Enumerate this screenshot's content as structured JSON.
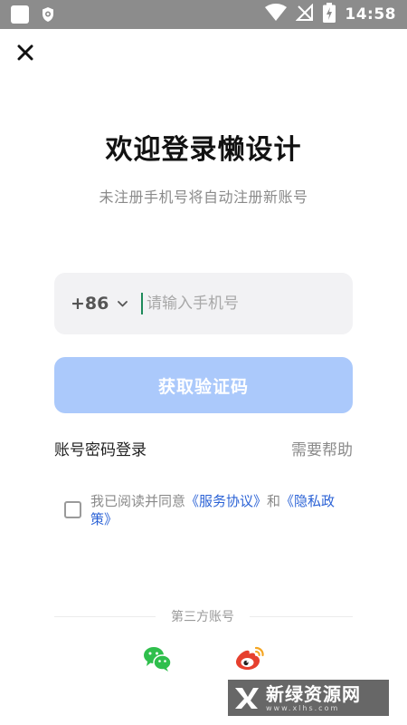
{
  "status_bar": {
    "time": "14:58"
  },
  "page": {
    "title": "欢迎登录懒设计",
    "subtitle": "未注册手机号将自动注册新账号"
  },
  "phone": {
    "country_code": "+86",
    "placeholder": "请输入手机号",
    "value": ""
  },
  "actions": {
    "get_code": "获取验证码",
    "password_login": "账号密码登录",
    "help": "需要帮助"
  },
  "agreement": {
    "prefix": "我已阅读并同意",
    "service": "《服务协议》",
    "and": "和",
    "privacy": "《隐私政策》",
    "checked": false
  },
  "third_party": {
    "label": "第三方账号",
    "icons": [
      "wechat-icon",
      "weibo-icon"
    ]
  },
  "watermark": {
    "text": "新绿资源网",
    "sub": "www.xlhs.com"
  },
  "colors": {
    "primary_button": "#abc9fb",
    "link": "#2c63d6",
    "input_bg": "#f2f2f4",
    "status_bar": "#8c8c8c"
  }
}
